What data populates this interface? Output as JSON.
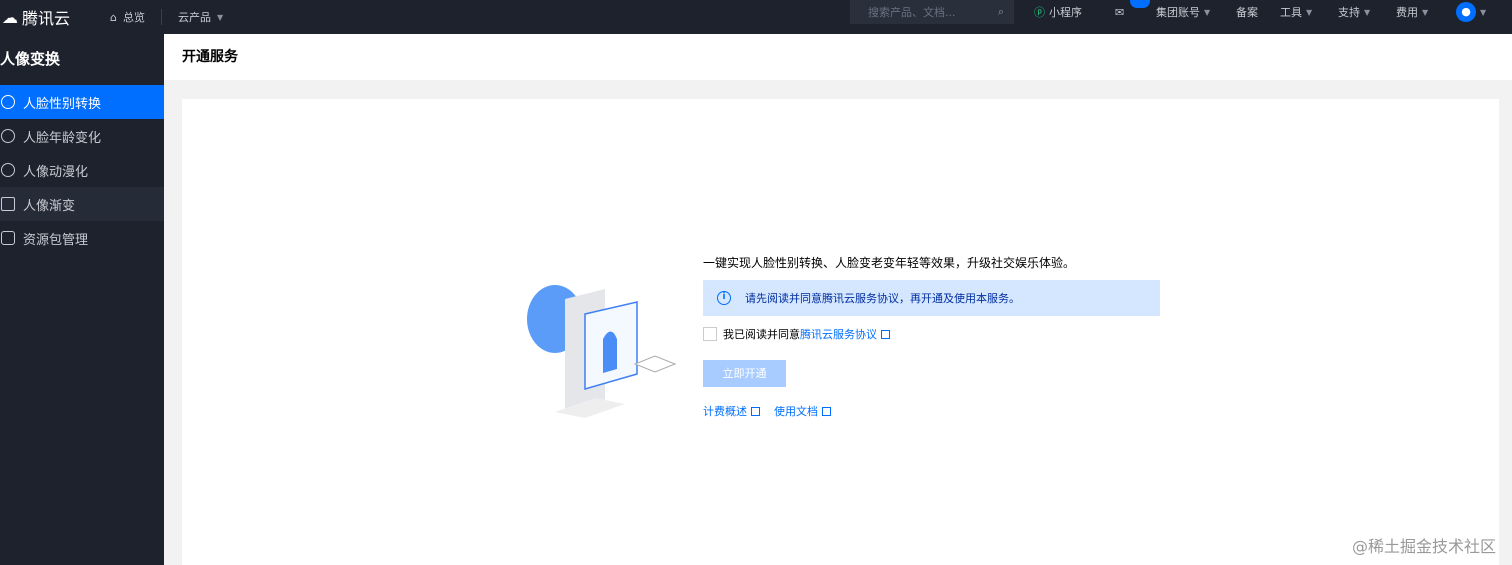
{
  "topbar": {
    "brand": "腾讯云",
    "overview": "总览",
    "products": "云产品",
    "search_placeholder": "搜索产品、文档...",
    "mini_program": "小程序",
    "group_account": "集团账号",
    "beian": "备案",
    "tools": "工具",
    "support": "支持",
    "billing": "费用"
  },
  "sidebar": {
    "title": "人像变换",
    "items": [
      {
        "label": "人脸性别转换"
      },
      {
        "label": "人脸年龄变化"
      },
      {
        "label": "人像动漫化"
      },
      {
        "label": "人像渐变"
      },
      {
        "label": "资源包管理"
      }
    ]
  },
  "page": {
    "title": "开通服务",
    "description": "一键实现人脸性别转换、人脸变老变年轻等效果，升级社交娱乐体验。",
    "notice": "请先阅读并同意腾讯云服务协议，再开通及使用本服务。",
    "agree_prefix": "我已阅读并同意",
    "agree_link": "腾讯云服务协议",
    "activate_button": "立即开通",
    "link_pricing": "计费概述",
    "link_docs": "使用文档"
  },
  "watermark": "@稀土掘金技术社区",
  "colors": {
    "accent": "#006eff",
    "topbar": "#1e222d"
  }
}
